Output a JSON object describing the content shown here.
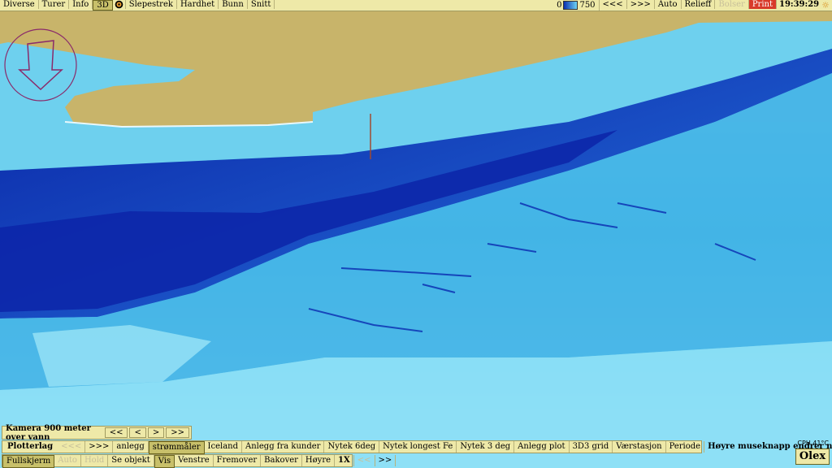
{
  "top_bar": {
    "menu": [
      "Diverse",
      "Turer",
      "Info",
      "3D",
      "Slepestrek",
      "Hardhet",
      "Bunn",
      "Snitt"
    ],
    "scale_min": "0",
    "scale_max": "750",
    "nav_back": "<<<",
    "nav_forward": ">>>",
    "auto": "Auto",
    "relief": "Relieff",
    "boluser": "Bolser",
    "print": "Print",
    "clock": "19:39:29"
  },
  "camera": {
    "label": "Kamera 900 meter over vann",
    "buttons": [
      "<<",
      "<",
      ">",
      ">>"
    ]
  },
  "plotter": {
    "title": "Plotterlag",
    "items": [
      "<<<",
      ">>>",
      "anlegg",
      "strømmåler",
      "Iceland",
      "Anlegg fra kunder",
      "Nytek 6deg",
      "Nytek longest Fe",
      "Nytek 3 deg",
      "Anlegg plot",
      "3D3 grid",
      "Værstasjon",
      "Periode",
      "Høyre museknapp endrer navn"
    ]
  },
  "bottom_bar": {
    "items": [
      "Fullskjerm",
      "Auto",
      "Hold",
      "Se objekt",
      "Vis",
      "Venstre",
      "Fremover",
      "Bakover",
      "Høyre",
      "1X",
      "<<",
      ">>"
    ]
  },
  "status": {
    "cpu": "CPU 41°C",
    "brand": "Olex"
  },
  "colors": {
    "land": "#c8b46a",
    "shallow": "#6ed4f2",
    "mid": "#2a8ed8",
    "deep": "#0c24a8",
    "bar": "#eee9a8"
  }
}
